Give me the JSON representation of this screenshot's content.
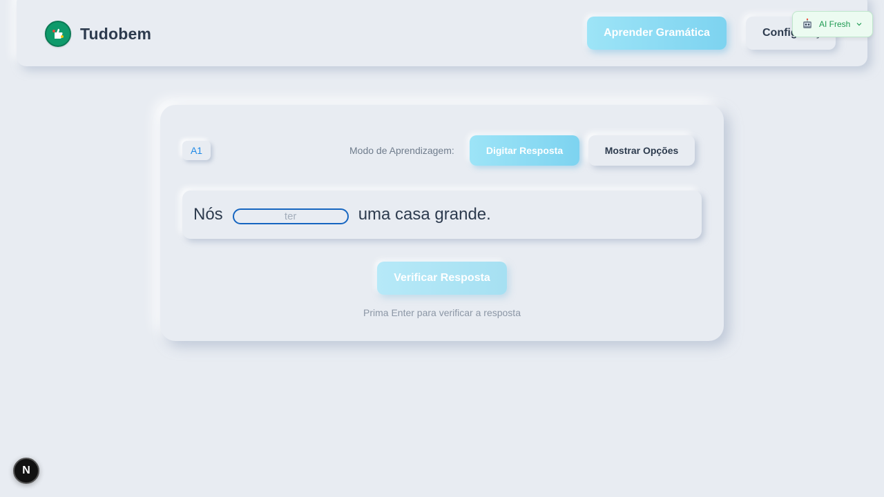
{
  "header": {
    "brand": "Tudobem",
    "grammar_button": "Aprender Gramática",
    "config_button": "Configurações"
  },
  "ai_badge": {
    "label": "AI Fresh",
    "icon": "robot-icon"
  },
  "exercise": {
    "level": "A1",
    "mode_label": "Modo de Aprendizagem:",
    "mode_type_button": "Digitar Resposta",
    "mode_options_button": "Mostrar Opções",
    "sentence_before": "Nós",
    "answer_placeholder": "ter",
    "answer_value": "",
    "sentence_after": "uma casa grande.",
    "verify_button": "Verificar Resposta",
    "hint": "Prima Enter para verificar a resposta"
  },
  "dev_indicator": {
    "label": "N"
  },
  "colors": {
    "background": "#e8ecf2",
    "accent": "#7dd3f0",
    "brand_green": "#0f9a6b",
    "level_blue": "#1e88e5",
    "input_border": "#1565c0"
  }
}
